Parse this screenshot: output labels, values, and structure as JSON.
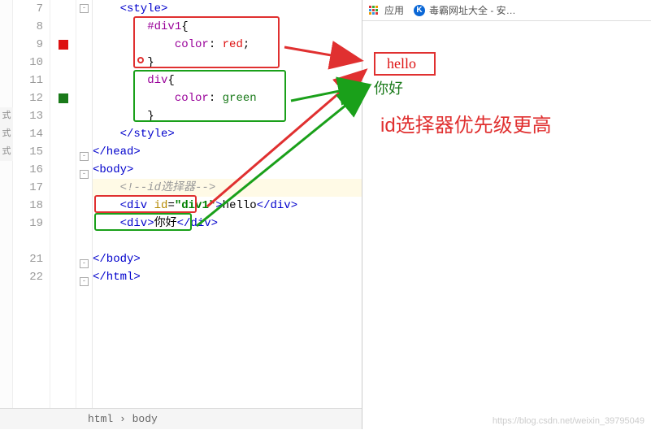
{
  "gutter": {
    "start": 7,
    "end": 22
  },
  "code": {
    "l7": "    <style>",
    "l8_a": "        #div1",
    "l8_b": "{",
    "l9_a": "            ",
    "l9_b": "color",
    "l9_c": ": ",
    "l9_d": "red",
    "l9_e": ";",
    "l10": "        }",
    "l11_a": "        div",
    "l11_b": "{",
    "l12_a": "            ",
    "l12_b": "color",
    "l12_c": ": ",
    "l12_d": "green",
    "l13": "        }",
    "l14": "    </style>",
    "l15": "</head>",
    "l16": "<body>",
    "l17": "    <!--id选择器-->",
    "l18_a": "    <div ",
    "l18_b": "id",
    "l18_c": "=",
    "l18_d": "\"div1\"",
    "l18_e": ">",
    "l18_f": "hello",
    "l18_g": "</div>",
    "l19_a": "    <div>",
    "l19_b": "你好",
    "l19_c": "</div>",
    "l21": "</body>",
    "l22": "</html>"
  },
  "breadcrumb": {
    "path1": "html",
    "sep": " › ",
    "path2": "body"
  },
  "bookmarks": {
    "apps": "应用",
    "item1": "毒霸网址大全 - 安…"
  },
  "page": {
    "hello": "hello",
    "nihao": "你好"
  },
  "annotation": "id选择器优先级更高",
  "watermark": "https://blog.csdn.net/weixin_39795049",
  "left_stubs": [
    "式",
    "式",
    "式"
  ]
}
